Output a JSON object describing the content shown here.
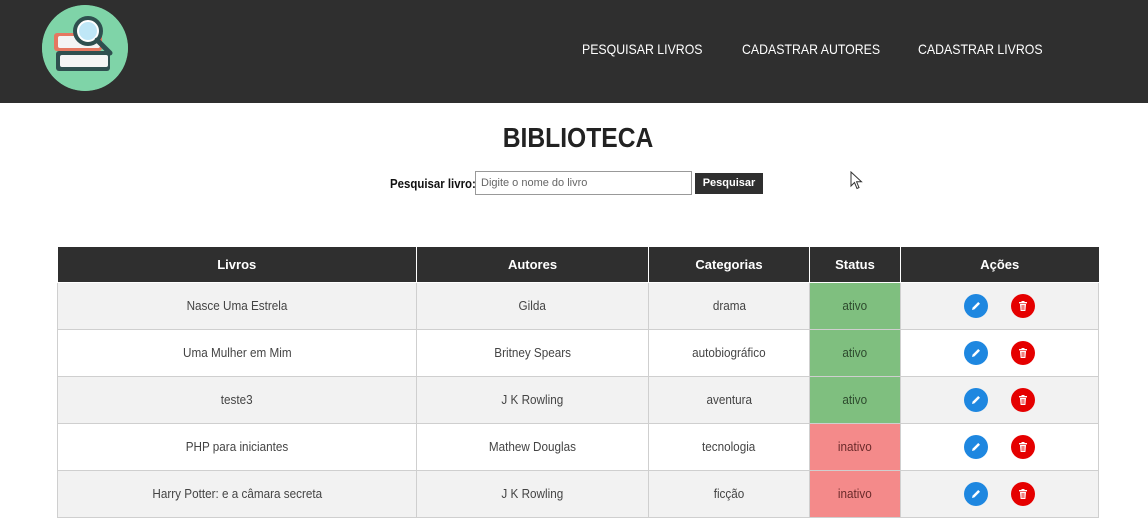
{
  "nav": {
    "links": [
      "PESQUISAR LIVROS",
      "CADASTRAR AUTORES",
      "CADASTRAR LIVROS"
    ]
  },
  "page": {
    "title": "BIBLIOTECA"
  },
  "search": {
    "label": "Pesquisar livro:",
    "placeholder": "Digite o nome do livro",
    "value": "",
    "button": "Pesquisar"
  },
  "table": {
    "headers": [
      "Livros",
      "Autores",
      "Categorias",
      "Status",
      "Ações"
    ],
    "rows": [
      {
        "livro": "Nasce Uma Estrela",
        "autor": "Gilda",
        "categoria": "drama",
        "status": "ativo"
      },
      {
        "livro": "Uma Mulher em Mim",
        "autor": "Britney Spears",
        "categoria": "autobiográfico",
        "status": "ativo"
      },
      {
        "livro": "teste3",
        "autor": "J K Rowling",
        "categoria": "aventura",
        "status": "ativo"
      },
      {
        "livro": "PHP para iniciantes",
        "autor": "Mathew Douglas",
        "categoria": "tecnologia",
        "status": "inativo"
      },
      {
        "livro": "Harry Potter: e a câmara secreta",
        "autor": "J K Rowling",
        "categoria": "ficção",
        "status": "inativo"
      }
    ]
  },
  "colors": {
    "navbar": "#2f2f2f",
    "status_ativo": "#7fbf7f",
    "status_inativo": "#f48a8a",
    "edit_icon": "#1e87e0",
    "delete_icon": "#e50000"
  },
  "icons": {
    "logo": "books-magnifier-logo",
    "edit": "pencil-icon",
    "delete": "trash-icon"
  }
}
